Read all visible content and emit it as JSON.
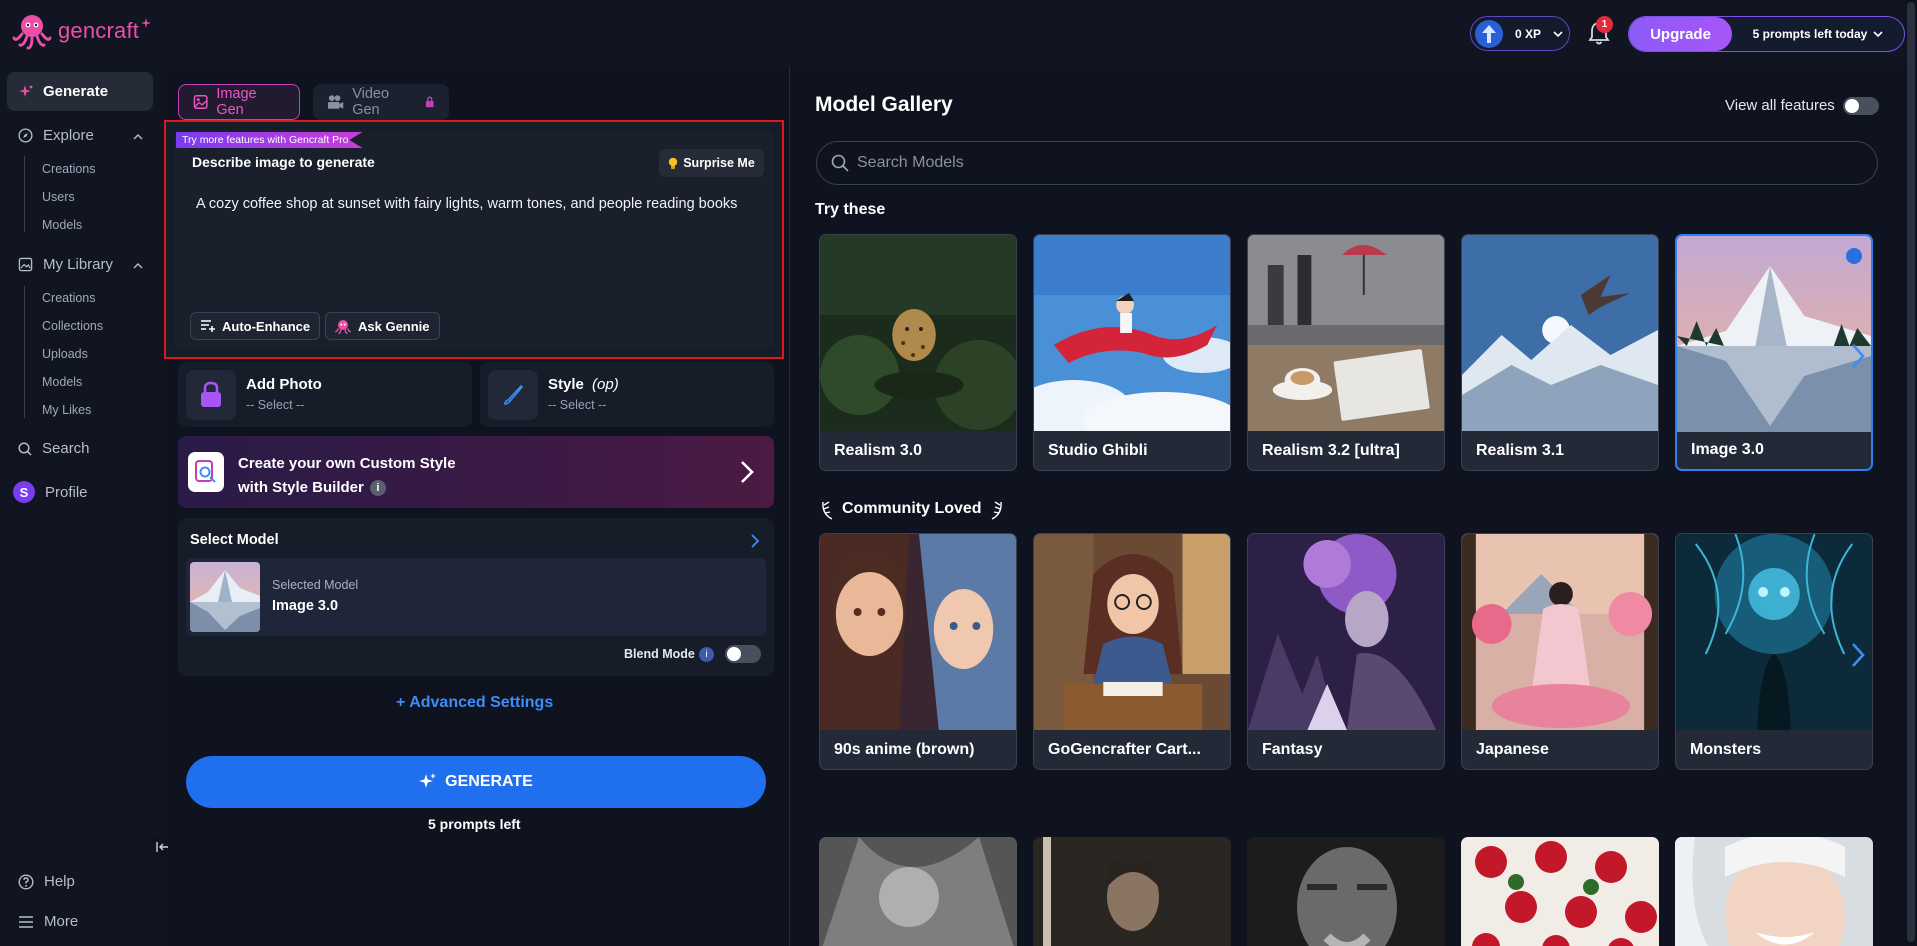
{
  "brand": {
    "name": "gencraft"
  },
  "header": {
    "xp": "0 XP",
    "notifications_count": "1",
    "upgrade_label": "Upgrade",
    "prompts_today": "5 prompts left today"
  },
  "sidebar": {
    "generate": "Generate",
    "explore": {
      "label": "Explore",
      "items": [
        "Creations",
        "Users",
        "Models"
      ]
    },
    "library": {
      "label": "My Library",
      "items": [
        "Creations",
        "Collections",
        "Uploads",
        "Models",
        "My Likes"
      ]
    },
    "search": "Search",
    "profile": {
      "initial": "S",
      "label": "Profile"
    },
    "help": "Help",
    "more": "More"
  },
  "tabs": {
    "image": "Image Gen",
    "video": "Video Gen"
  },
  "prompt": {
    "ribbon": "Try more features with Gencraft Pro",
    "label": "Describe image to generate",
    "surprise": "Surprise Me",
    "text": "A cozy coffee shop at sunset with fairy lights, warm tones, and people reading books",
    "auto_enhance": "Auto-Enhance",
    "ask_gennie": "Ask Gennie"
  },
  "options": {
    "add_photo": {
      "title": "Add Photo",
      "value": "-- Select --"
    },
    "style": {
      "title": "Style",
      "suffix": "(op)",
      "value": "-- Select --"
    }
  },
  "custom_style": {
    "line1": "Create your own Custom Style",
    "line2": "with Style Builder",
    "info": "i"
  },
  "select_model": {
    "title": "Select Model",
    "selected_label": "Selected Model",
    "selected_name": "Image 3.0",
    "blend_label": "Blend Mode",
    "blend_info": "i",
    "blend_on": false
  },
  "advanced_settings": "+ Advanced Settings",
  "generate": {
    "label": "GENERATE",
    "prompts_left": "5 prompts left"
  },
  "gallery": {
    "title": "Model Gallery",
    "view_all": "View all features",
    "view_all_on": false,
    "search_placeholder": "Search Models",
    "try_these_title": "Try these",
    "try_these": [
      "Realism 3.0",
      "Studio Ghibli",
      "Realism 3.2 [ultra]",
      "Realism 3.1",
      "Image 3.0"
    ],
    "selected_index": 4,
    "community_title": "Community Loved",
    "community": [
      "90s anime (brown)",
      "GoGencrafter Cart...",
      "Fantasy",
      "Japanese",
      "Monsters"
    ]
  },
  "colors": {
    "accent_blue": "#1f6fee",
    "brand_pink": "#ec4fa8",
    "upgrade_purple": "#a855f7",
    "highlight_red": "#e0161e"
  }
}
